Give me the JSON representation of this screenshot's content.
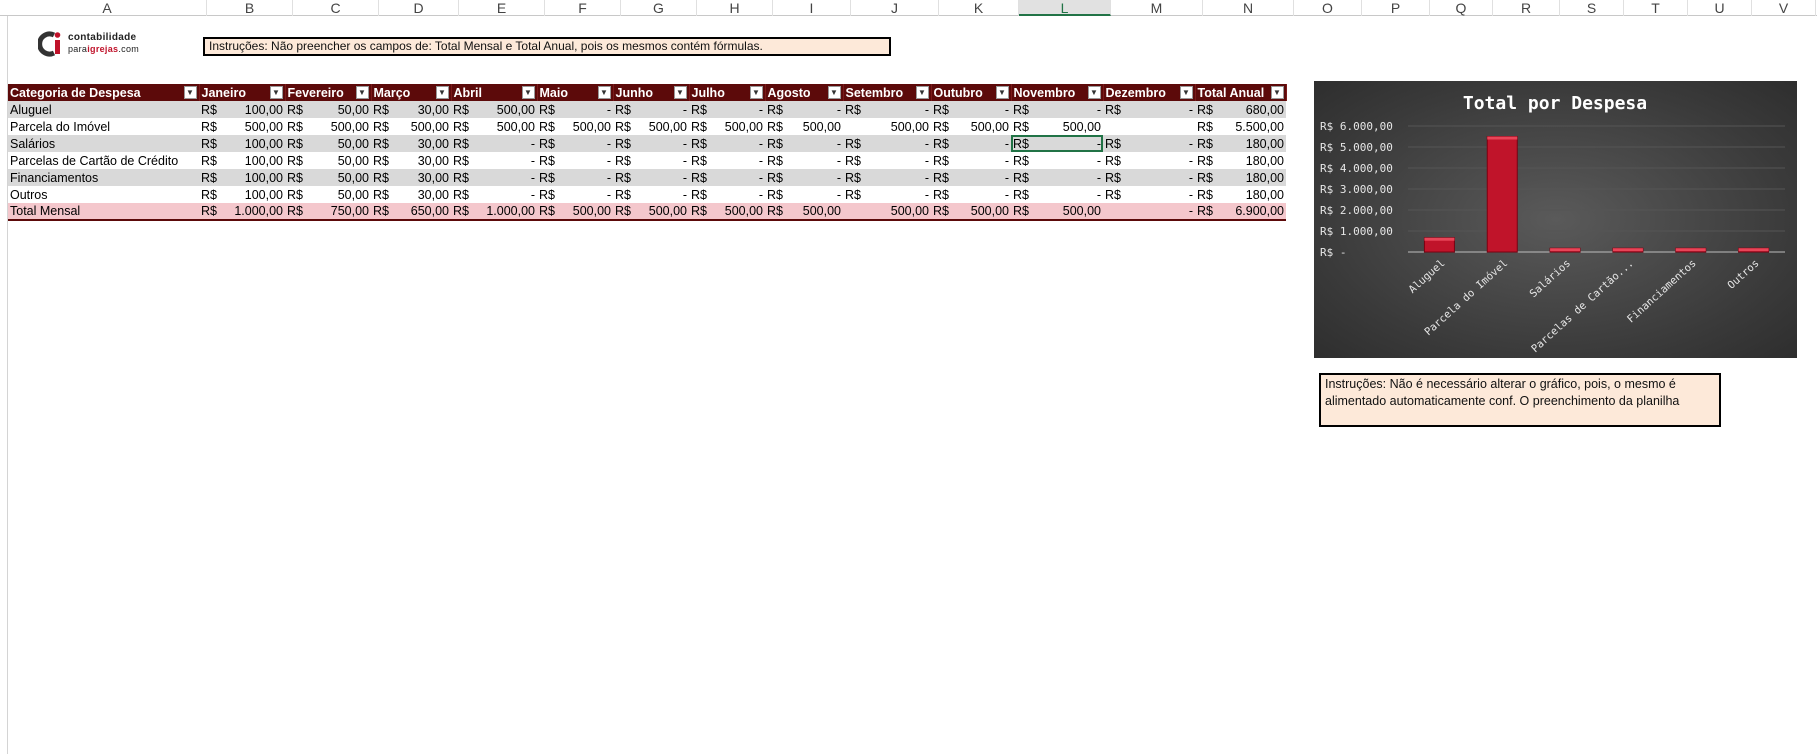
{
  "columns": [
    "A",
    "B",
    "C",
    "D",
    "E",
    "F",
    "G",
    "H",
    "I",
    "J",
    "K",
    "L",
    "M",
    "N",
    "O",
    "P",
    "Q",
    "R",
    "S",
    "T",
    "U",
    "V"
  ],
  "selected_column": "L",
  "logo": {
    "line1": "contabilidade",
    "line2_prefix": "para",
    "line2_brand": "igrejas",
    "line2_suffix": ".com"
  },
  "instructions_top": "Instruções: Não preencher os campos de: Total Mensal e Total Anual, pois os mesmos contém fórmulas.",
  "instructions_chart": "Instruções: Não é necessário alterar o gráfico, pois, o mesmo é alimentado automaticamente conf. O preenchimento da planilha",
  "table": {
    "headers": [
      "Categoria de Despesa",
      "Janeiro",
      "Fevereiro",
      "Março",
      "Abril",
      "Maio",
      "Junho",
      "Julho",
      "Agosto",
      "Setembro",
      "Outubro",
      "Novembro",
      "Dezembro",
      "Total Anual"
    ],
    "rows": [
      {
        "cat": "Aluguel",
        "vals": [
          "100,00",
          "50,00",
          "30,00",
          "500,00",
          "-",
          "-",
          "-",
          "-",
          "-",
          "-",
          "-",
          "-",
          "680,00"
        ]
      },
      {
        "cat": "Parcela do Imóvel",
        "vals": [
          "500,00",
          "500,00",
          "500,00",
          "500,00",
          "500,00",
          "500,00",
          "500,00",
          "500,00",
          "500,00",
          "500,00",
          "500,00",
          "",
          "5.500,00"
        ]
      },
      {
        "cat": "Salários",
        "vals": [
          "100,00",
          "50,00",
          "30,00",
          "-",
          "-",
          "-",
          "-",
          "-",
          "-",
          "-",
          "-",
          "-",
          "180,00"
        ]
      },
      {
        "cat": "Parcelas de Cartão de Crédito",
        "vals": [
          "100,00",
          "50,00",
          "30,00",
          "-",
          "-",
          "-",
          "-",
          "-",
          "-",
          "-",
          "-",
          "-",
          "180,00"
        ]
      },
      {
        "cat": "Financiamentos",
        "vals": [
          "100,00",
          "50,00",
          "30,00",
          "-",
          "-",
          "-",
          "-",
          "-",
          "-",
          "-",
          "-",
          "-",
          "180,00"
        ]
      },
      {
        "cat": "Outros",
        "vals": [
          "100,00",
          "50,00",
          "30,00",
          "-",
          "-",
          "-",
          "-",
          "-",
          "-",
          "-",
          "-",
          "-",
          "180,00"
        ]
      },
      {
        "cat": "Total Mensal",
        "vals": [
          "1.000,00",
          "750,00",
          "650,00",
          "1.000,00",
          "500,00",
          "500,00",
          "500,00",
          "500,00",
          "500,00",
          "500,00",
          "500,00",
          "-",
          "6.900,00"
        ]
      }
    ],
    "currency_rows": [
      [
        true,
        true,
        true,
        true,
        true,
        true,
        true,
        true,
        true,
        true,
        true,
        true,
        true
      ],
      [
        true,
        true,
        true,
        true,
        true,
        true,
        true,
        true,
        false,
        true,
        true,
        false,
        true
      ],
      [
        true,
        true,
        true,
        true,
        true,
        true,
        true,
        true,
        true,
        true,
        true,
        true,
        true
      ],
      [
        true,
        true,
        true,
        true,
        true,
        true,
        true,
        true,
        true,
        true,
        true,
        true,
        true
      ],
      [
        true,
        true,
        true,
        true,
        true,
        true,
        true,
        true,
        true,
        true,
        true,
        true,
        true
      ],
      [
        true,
        true,
        true,
        true,
        true,
        true,
        true,
        true,
        true,
        true,
        true,
        true,
        true
      ],
      [
        true,
        true,
        true,
        true,
        true,
        true,
        true,
        true,
        false,
        true,
        true,
        false,
        true
      ]
    ],
    "currency": "R$"
  },
  "chart_data": {
    "type": "bar",
    "title": "Total por Despesa",
    "categories": [
      "Aluguel",
      "Parcela do Imóvel",
      "Salários",
      "Parcelas de Cartão...",
      "Financiamentos",
      "Outros"
    ],
    "values": [
      680,
      5500,
      180,
      180,
      180,
      180
    ],
    "ylim": [
      0,
      6000
    ],
    "yticks": [
      "R$ -",
      "R$ 1.000,00",
      "R$ 2.000,00",
      "R$ 3.000,00",
      "R$ 4.000,00",
      "R$ 5.000,00",
      "R$ 6.000,00"
    ],
    "bar_color": "#c0142a",
    "grid": true
  }
}
